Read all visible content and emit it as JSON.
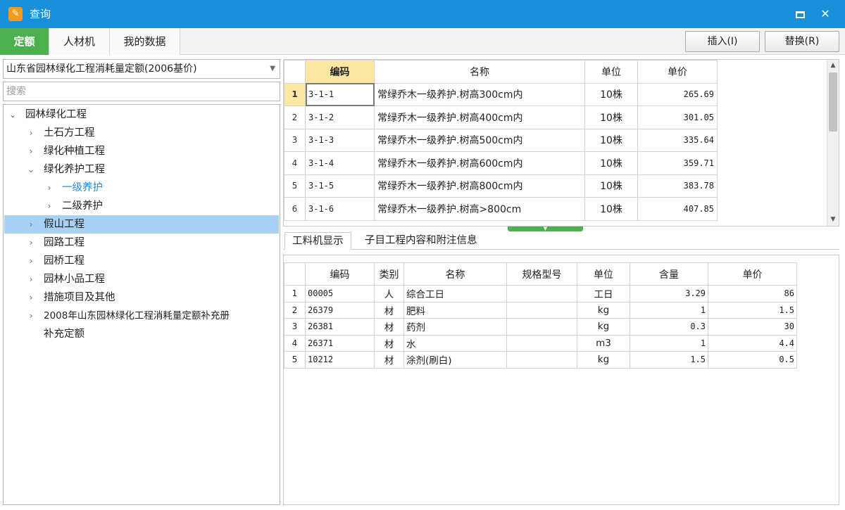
{
  "window": {
    "title": "查询",
    "app_icon": "app-logo-icon",
    "maximize_icon": "maximize-icon",
    "close_glyph": "✕"
  },
  "tabs": [
    {
      "label": "定额"
    },
    {
      "label": "人材机"
    },
    {
      "label": "我的数据"
    }
  ],
  "toolbar": {
    "insert_label": "插入(I)",
    "replace_label": "替换(R)"
  },
  "colors": {
    "titlebar": "#1890d9",
    "active_tab": "#4caf50",
    "selected_tree": "#a7d2f6",
    "header_highlight": "#fce8a4",
    "link_blue": "#2b8be0"
  },
  "library_select": {
    "value": "山东省园林绿化工程消耗量定额(2006基价)"
  },
  "search": {
    "placeholder": "搜索"
  },
  "tree": [
    {
      "label": "园林绿化工程",
      "arrow": "⌄",
      "expanded": true
    },
    {
      "label": "土石方工程",
      "arrow": "›"
    },
    {
      "label": "绿化种植工程",
      "arrow": "›"
    },
    {
      "label": "绿化养护工程",
      "arrow": "⌄",
      "expanded": true
    },
    {
      "label": "一级养护",
      "arrow": "›",
      "active": true
    },
    {
      "label": "二级养护",
      "arrow": "›"
    },
    {
      "label": "假山工程",
      "arrow": "›",
      "selected": true
    },
    {
      "label": "园路工程",
      "arrow": "›"
    },
    {
      "label": "园桥工程",
      "arrow": "›"
    },
    {
      "label": "园林小品工程",
      "arrow": "›"
    },
    {
      "label": "措施项目及其他",
      "arrow": "›"
    },
    {
      "label": "2008年山东园林绿化工程消耗量定额补充册",
      "arrow": "›"
    },
    {
      "label": "补充定额",
      "arrow": ""
    }
  ],
  "quota_table": {
    "columns": {
      "code": "编码",
      "name": "名称",
      "unit": "单位",
      "price": "单价"
    },
    "rows": [
      {
        "no": "1",
        "code": "3-1-1",
        "name": "常绿乔木一级养护.树高300cm内",
        "unit": "10株",
        "price": "265.69"
      },
      {
        "no": "2",
        "code": "3-1-2",
        "name": "常绿乔木一级养护.树高400cm内",
        "unit": "10株",
        "price": "301.05"
      },
      {
        "no": "3",
        "code": "3-1-3",
        "name": "常绿乔木一级养护.树高500cm内",
        "unit": "10株",
        "price": "335.64"
      },
      {
        "no": "4",
        "code": "3-1-4",
        "name": "常绿乔木一级养护.树高600cm内",
        "unit": "10株",
        "price": "359.71"
      },
      {
        "no": "5",
        "code": "3-1-5",
        "name": "常绿乔木一级养护.树高800cm内",
        "unit": "10株",
        "price": "383.78"
      },
      {
        "no": "6",
        "code": "3-1-6",
        "name": "常绿乔木一级养护.树高>800cm",
        "unit": "10株",
        "price": "407.85"
      }
    ]
  },
  "sub_tabs": [
    {
      "label": "工料机显示"
    },
    {
      "label": "子目工程内容和附注信息"
    }
  ],
  "material_table": {
    "columns": {
      "code": "编码",
      "type": "类别",
      "name": "名称",
      "spec": "规格型号",
      "unit": "单位",
      "qty": "含量",
      "price": "单价"
    },
    "rows": [
      {
        "no": "1",
        "code": "00005",
        "type": "人",
        "name": "综合工日",
        "spec": "",
        "unit": "工日",
        "qty": "3.29",
        "price": "86"
      },
      {
        "no": "2",
        "code": "26379",
        "type": "材",
        "name": "肥料",
        "spec": "",
        "unit": "kg",
        "qty": "1",
        "price": "1.5"
      },
      {
        "no": "3",
        "code": "26381",
        "type": "材",
        "name": "药剂",
        "spec": "",
        "unit": "kg",
        "qty": "0.3",
        "price": "30"
      },
      {
        "no": "4",
        "code": "26371",
        "type": "材",
        "name": "水",
        "spec": "",
        "unit": "m3",
        "qty": "1",
        "price": "4.4"
      },
      {
        "no": "5",
        "code": "10212",
        "type": "材",
        "name": "涂剂(刷白)",
        "spec": "",
        "unit": "kg",
        "qty": "1.5",
        "price": "0.5"
      }
    ]
  }
}
